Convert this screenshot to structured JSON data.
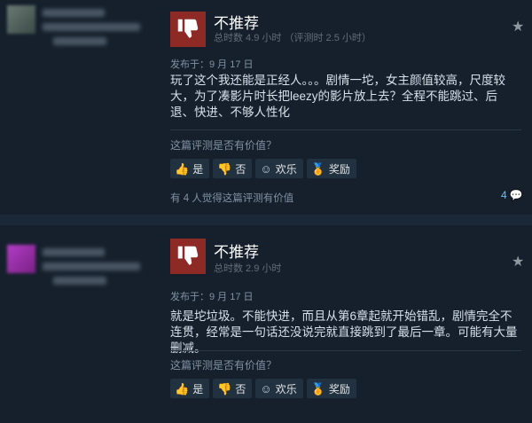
{
  "reviews": [
    {
      "verdict": "不推荐",
      "hours": "总时数 4.9 小时 （评测时 2.5 小时）",
      "posted": "发布于：9 月 17 日",
      "body": "玩了这个我还能是正经人。。。剧情一坨，女主颜值较高，尺度较大，为了凑影片时长把leezy的影片放上去？全程不能跳过、后退、快进、不够人性化",
      "helpful_question": "这篇评测是否有价值？",
      "buttons": {
        "yes": "是",
        "no": "否",
        "funny": "欢乐",
        "award": "奖励"
      },
      "found_helpful": "有 4 人觉得这篇评测有价值",
      "comment_count": "4"
    },
    {
      "verdict": "不推荐",
      "hours": "总时数 2.9 小时",
      "posted": "发布于：9 月 17 日",
      "body": "就是坨垃圾。不能快进，而且从第6章起就开始错乱，剧情完全不连贯，经常是一句话还没说完就直接跳到了最后一章。可能有大量删减。",
      "helpful_question": "这篇评测是否有价值？",
      "buttons": {
        "yes": "是",
        "no": "否",
        "funny": "欢乐",
        "award": "奖励"
      }
    }
  ],
  "icons": {
    "verdict": "thumbs-down-icon",
    "star": "star-icon",
    "yes": "thumbs-up-icon",
    "no": "thumbs-down-icon",
    "funny": "smiley-icon",
    "award": "award-icon",
    "comment": "comment-icon"
  },
  "colors": {
    "background": "#1b2838",
    "review_bg": "#16202d",
    "not_recommended": "#8e2a25",
    "link_blue": "#66c0f4"
  }
}
